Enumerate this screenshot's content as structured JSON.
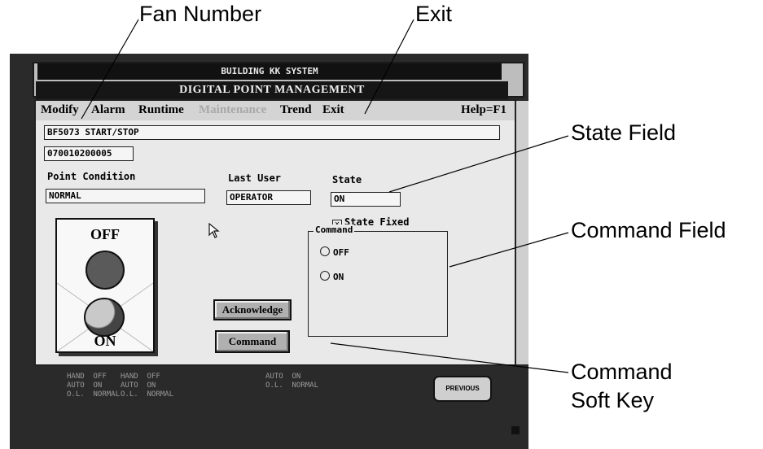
{
  "callouts": {
    "fan_number": "Fan Number",
    "exit": "Exit",
    "state_field": "State Field",
    "command_field": "Command Field",
    "command_soft_key_line1": "Command",
    "command_soft_key_line2": "Soft Key"
  },
  "screen": {
    "system_title": "BUILDING KK SYSTEM",
    "window_title": "DIGITAL POINT MANAGEMENT",
    "menu": {
      "modify": "Modify",
      "alarm": "Alarm",
      "runtime": "Runtime",
      "maintenance": "Maintenance",
      "trend": "Trend",
      "exit": "Exit",
      "help": "Help=F1"
    },
    "point_name": "BF5073 START/STOP",
    "point_id": "070010200005",
    "point_condition_label": "Point Condition",
    "point_condition_value": "NORMAL",
    "last_user_label": "Last User",
    "last_user_value": "OPERATOR",
    "state_label": "State",
    "state_value": "ON",
    "state_fixed_label": "State Fixed",
    "state_fixed_checked": true,
    "command_group_label": "Command",
    "command_options": [
      "OFF",
      "ON"
    ],
    "panel_off_label": "OFF",
    "panel_on_label": "ON",
    "acknowledge_button": "Acknowledge",
    "command_button": "Command",
    "previous_button": "PREVIOUS",
    "background_status": {
      "col1": "HAND  OFF\nAUTO  ON\nO.L.  NORMAL",
      "col2": "HAND  OFF\nAUTO  ON\nO.L.  NORMAL",
      "col3": "AUTO  ON\nO.L.  NORMAL"
    }
  }
}
